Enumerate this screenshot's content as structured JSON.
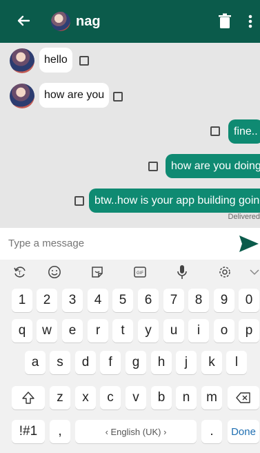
{
  "header": {
    "title": "nag",
    "back_icon": "arrow-left-icon",
    "delete_icon": "trash-icon",
    "menu_icon": "more-vert-icon"
  },
  "messages": [
    {
      "direction": "in",
      "text": "hello"
    },
    {
      "direction": "in",
      "text": "how are you"
    },
    {
      "direction": "out",
      "text": "fine.."
    },
    {
      "direction": "out",
      "text": "how are you doing"
    },
    {
      "direction": "out",
      "text": "btw..how is your app building going"
    }
  ],
  "status": {
    "delivered": "Delivered"
  },
  "composer": {
    "placeholder": "Type a message",
    "send_icon": "send-icon"
  },
  "keyboard": {
    "tool_icons": [
      "rotate-icon",
      "emoji-icon",
      "sticker-icon",
      "gif-icon",
      "mic-icon",
      "settings-icon",
      "chevron-down-icon"
    ],
    "numbers": [
      "1",
      "2",
      "3",
      "4",
      "5",
      "6",
      "7",
      "8",
      "9",
      "0"
    ],
    "row1": [
      "q",
      "w",
      "e",
      "r",
      "t",
      "y",
      "u",
      "i",
      "o",
      "p"
    ],
    "row2": [
      "a",
      "s",
      "d",
      "f",
      "g",
      "h",
      "j",
      "k",
      "l"
    ],
    "row3": [
      "z",
      "x",
      "c",
      "v",
      "b",
      "n",
      "m"
    ],
    "bottom": {
      "symbols": "!#1",
      "comma": ",",
      "space": "‹ English (UK) ›",
      "period": ".",
      "done": "Done"
    }
  },
  "colors": {
    "header": "#0b5b4b",
    "outgoing": "#0f8a72",
    "send": "#0b5b4b"
  }
}
